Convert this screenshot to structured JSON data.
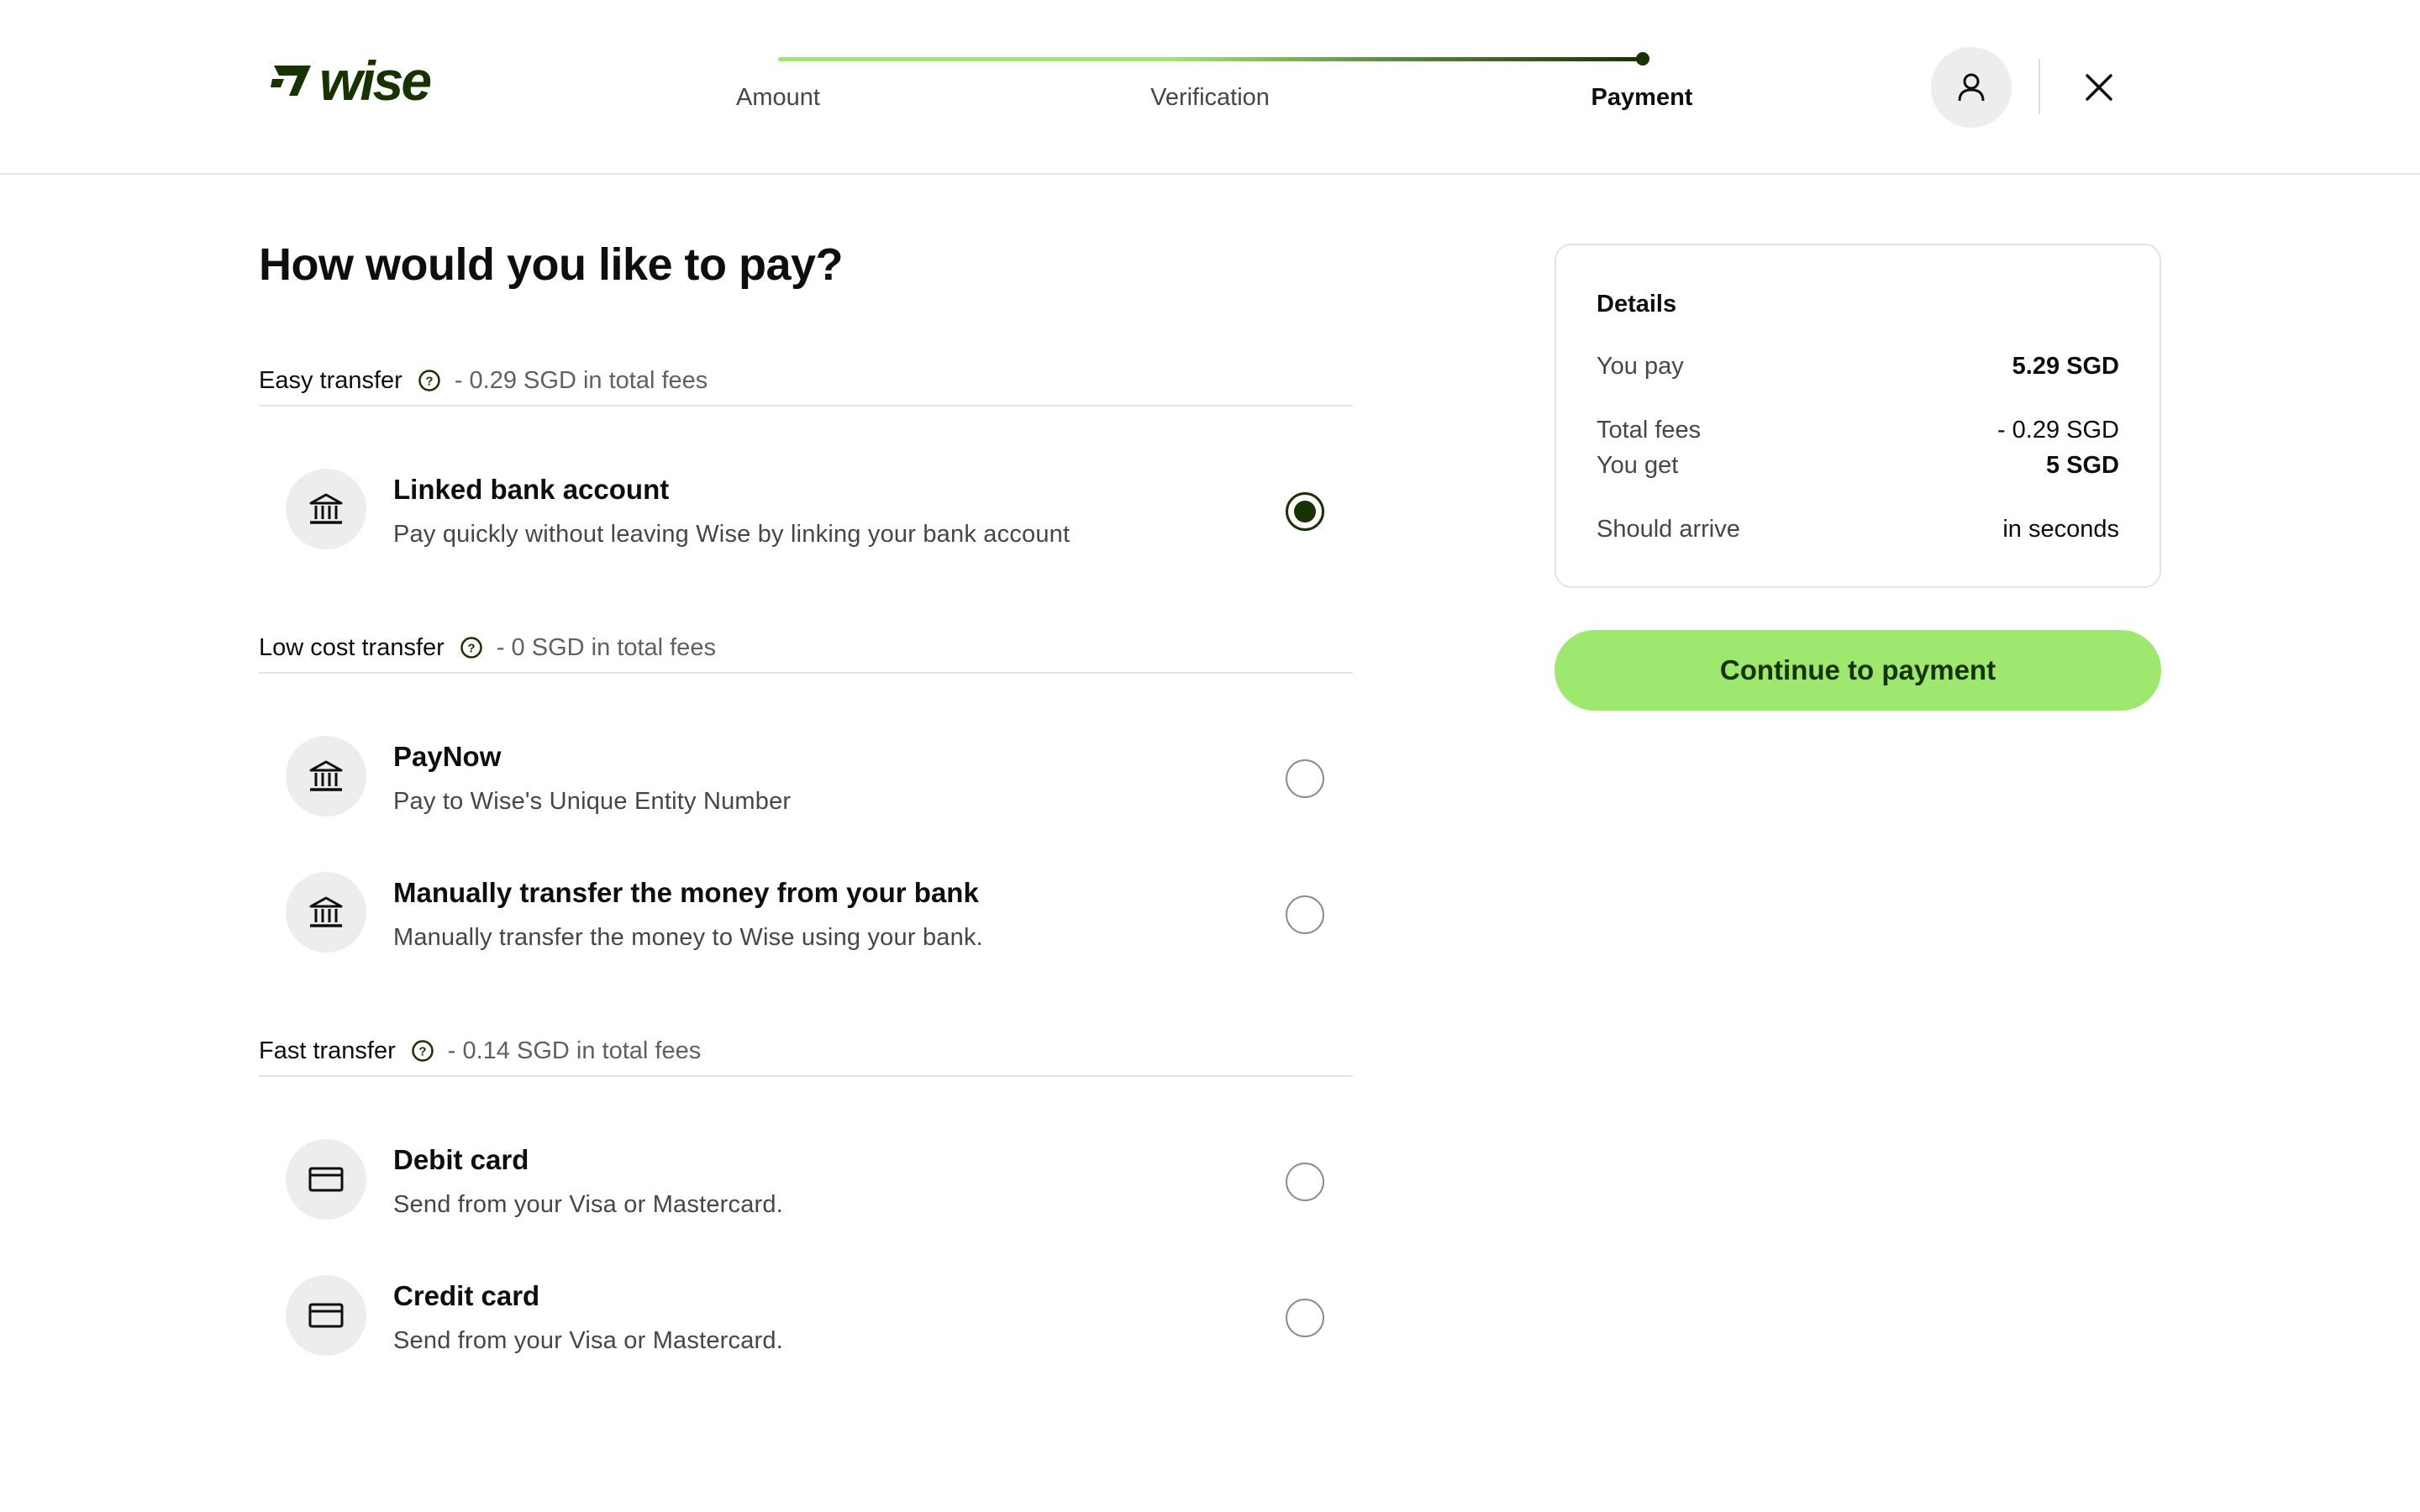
{
  "brand": {
    "name": "wise",
    "color": "#163300",
    "accent": "#9fe870"
  },
  "stepper": {
    "steps": [
      {
        "label": "Amount",
        "active": false
      },
      {
        "label": "Verification",
        "active": false
      },
      {
        "label": "Payment",
        "active": true
      }
    ]
  },
  "header": {
    "account_icon": "user-icon",
    "close_icon": "close-icon"
  },
  "main": {
    "title": "How would you like to pay?",
    "sections": [
      {
        "title": "Easy transfer",
        "fees": "- 0.29 SGD in total fees",
        "options": [
          {
            "title": "Linked bank account",
            "desc": "Pay quickly without leaving Wise by linking your bank account",
            "icon": "bank-icon",
            "selected": true
          }
        ]
      },
      {
        "title": "Low cost transfer",
        "fees": "- 0 SGD in total fees",
        "options": [
          {
            "title": "PayNow",
            "desc": "Pay to Wise's Unique Entity Number",
            "icon": "bank-icon",
            "selected": false
          },
          {
            "title": "Manually transfer the money from your bank",
            "desc": "Manually transfer the money to Wise using your bank.",
            "icon": "bank-icon",
            "selected": false
          }
        ]
      },
      {
        "title": "Fast transfer",
        "fees": "- 0.14 SGD in total fees",
        "options": [
          {
            "title": "Debit card",
            "desc": "Send from your Visa or Mastercard.",
            "icon": "card-icon",
            "selected": false
          },
          {
            "title": "Credit card",
            "desc": "Send from your Visa or Mastercard.",
            "icon": "card-icon",
            "selected": false
          }
        ]
      }
    ]
  },
  "details": {
    "title": "Details",
    "you_pay_label": "You pay",
    "you_pay_value": "5.29 SGD",
    "total_fees_label": "Total fees",
    "total_fees_value": "- 0.29 SGD",
    "you_get_label": "You get",
    "you_get_value": "5 SGD",
    "arrive_label": "Should arrive",
    "arrive_value": "in seconds"
  },
  "continue_label": "Continue to payment"
}
